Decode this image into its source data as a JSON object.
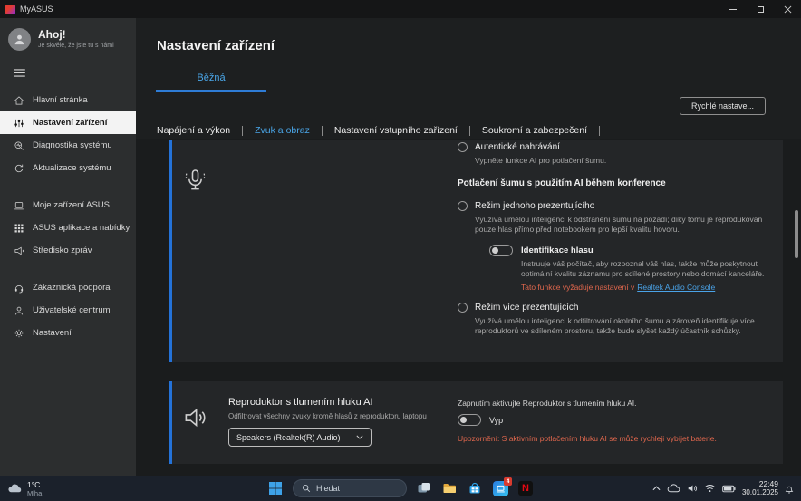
{
  "titlebar": {
    "title": "MyASUS"
  },
  "sidebar": {
    "greeting": "Ahoj!",
    "greeting_sub": "Je skvělé, že jste tu s námi",
    "items": [
      {
        "label": "Hlavní stránka"
      },
      {
        "label": "Nastavení zařízení",
        "selected": true
      },
      {
        "label": "Diagnostika systému"
      },
      {
        "label": "Aktualizace systému"
      },
      {
        "label": "Moje zařízení ASUS"
      },
      {
        "label": "ASUS aplikace a nabídky"
      },
      {
        "label": "Středisko zpráv"
      },
      {
        "label": "Zákaznická podpora"
      },
      {
        "label": "Uživatelské centrum"
      },
      {
        "label": "Nastavení"
      }
    ]
  },
  "header": {
    "title": "Nastavení zařízení",
    "tab": "Běžná",
    "quick_settings": "Rychlé nastave..."
  },
  "subnav": {
    "items": [
      "Napájení a výkon",
      "Zvuk a obraz",
      "Nastavení vstupního zařízení",
      "Soukromí a zabezpečení"
    ],
    "active": "Zvuk a obraz"
  },
  "mic_section": {
    "option_authentic": {
      "label": "Autentické nahrávání",
      "desc": "Vypněte funkce AI pro potlačení šumu."
    },
    "group_title": "Potlačení šumu s použitím AI během konference",
    "option_single": {
      "label": "Režim jednoho prezentujícího",
      "desc": "Využívá umělou inteligenci k odstranění šumu na pozadí; díky tomu je reprodukován pouze hlas přímo před notebookem pro lepší kvalitu hovoru."
    },
    "voice_id": {
      "label": "Identifikace hlasu",
      "state": "off",
      "desc": "Instruuje váš počítač, aby rozpoznal váš hlas, takže může poskytnout optimální kvalitu záznamu pro sdílené prostory nebo domácí kanceláře.",
      "note_prefix": "Tato funkce vyžaduje nastavení v",
      "note_link": "Realtek Audio Console",
      "note_suffix": "."
    },
    "option_multi": {
      "label": "Režim více prezentujících",
      "desc": "Využívá umělou inteligenci k odfiltrování okolního šumu a zároveň identifikuje více reproduktorů ve sdíleném prostoru, takže bude slyšet každý účastník schůzky."
    }
  },
  "speaker_section": {
    "title": "Reproduktor s tlumením hluku AI",
    "subtitle": "Odfiltrovat všechny zvuky kromě hlasů z reproduktoru laptopu",
    "dropdown_value": "Speakers (Realtek(R) Audio)",
    "toggle_caption": "Zapnutím aktivujte Reproduktor s tlumením hluku AI.",
    "toggle_state": "off",
    "toggle_state_label": "Vyp",
    "warning": "Upozornění: S aktivním potlačením hluku AI se může rychleji vybíjet baterie."
  },
  "taskbar": {
    "weather": {
      "temp": "1°C",
      "condition": "Mlha"
    },
    "search_placeholder": "Hledat",
    "myasus_badge": "4",
    "netflix_letter": "N",
    "clock": {
      "time": "22:49",
      "date": "30.01.2025"
    }
  },
  "colors": {
    "accent_blue": "#2472d8",
    "tab_blue": "#4aa6e8",
    "warning_orange": "#e0674d",
    "link_blue": "#4aa3e8",
    "selected_item_bg": "#f3f3f3",
    "taskbar_bg": "#1b212b"
  },
  "icons": [
    "myasus-logo",
    "minimize",
    "maximize",
    "close",
    "user",
    "hamburger",
    "home",
    "device-settings",
    "diagnostics",
    "system-update",
    "laptop",
    "apps-grid",
    "megaphone",
    "headset",
    "user-center",
    "gear",
    "microphone",
    "speaker",
    "chevron-down",
    "windows-logo",
    "search",
    "task-view",
    "folder",
    "store",
    "netflix",
    "chevron-up",
    "cloud",
    "volume",
    "wifi",
    "battery",
    "bell",
    "weather-cloud"
  ]
}
